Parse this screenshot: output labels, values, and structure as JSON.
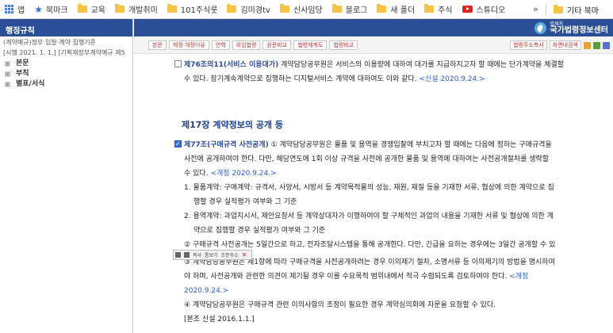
{
  "bookmarks": {
    "items": [
      {
        "label": "앱",
        "icon": "apps-grid-icon"
      },
      {
        "label": "북마크",
        "icon": "star-icon"
      },
      {
        "label": "교육",
        "icon": "folder-icon"
      },
      {
        "label": "개발취미",
        "icon": "folder-icon"
      },
      {
        "label": "101주식룻",
        "icon": "folder-icon"
      },
      {
        "label": "김미경tv",
        "icon": "folder-icon"
      },
      {
        "label": "신사임당",
        "icon": "folder-icon"
      },
      {
        "label": "블로그",
        "icon": "folder-icon"
      },
      {
        "label": "새 폴더",
        "icon": "folder-icon"
      },
      {
        "label": "주식",
        "icon": "folder-icon"
      },
      {
        "label": "스튜디오",
        "icon": "youtube-icon"
      }
    ],
    "overflow": "»",
    "other_label": "기타 북마"
  },
  "sidebar": {
    "title": "행정규칙",
    "subtitle_line1": "(계약예규)정부 입찰·계약 집행기준",
    "subtitle_line2": "[시행 2021. 1. 1.] [기획재정부계약예규 제5",
    "tree": [
      "본문",
      "부칙",
      "별표/서식"
    ]
  },
  "header": {
    "logo_small": "법제처",
    "logo_big": "국가법령정보센터"
  },
  "toolbar": {
    "buttons": [
      "본문",
      "제정·개정이유",
      "연혁",
      "위임법령",
      "원문비교",
      "법령체계도",
      "법령비교"
    ],
    "right_buttons": [
      "법령주소복사",
      "화면내검색"
    ]
  },
  "content": {
    "art76_title": "제76조의11(서비스 이용대가)",
    "art76_text1": " 계약담당공무원은 서비스의 이용량에 대하여 대가를 지급하지고자 할 때에는 단가계약을 체결할",
    "art76_text2": "수 있다. 장기계속계약으로 집행하는 디지털서비스 계약에 대하여도 이와 같다.",
    "art76_amend": "<신설 2020.9.24.>",
    "chapter": "제17장 계약정보의 공개 등",
    "art77_title": "제77조(구매규격 사전공개)",
    "art77_l1": " ① 계약담당공무원은 물품 및 용역을 경쟁입찰에 부치고자 할 때에는 다음에 정하는 구매규격을",
    "art77_l2": "사전에 공개하여야 한다. 다만, 해당연도에 1회 이상 규격을 사전에 공개한 물품 및 용역에 대하여는 사전공개절차를 생략할",
    "art77_l3": "수 있다.",
    "art77_amend1": "<개정 2020.9.24.>",
    "item1_l1": "1. 물품계약: 구매계약: 규격서, 사양서, 시방서 등 계약목적물의 성능, 재원, 재질 등을 기재한 서류, 협상에 의한 계약으로 집",
    "item1_l2": "행할 경우 실적평가 여부와 그 기준",
    "item2_l1": "2. 용역계약: 과업지시서, 제안요청서 등 계약상대자가 이행하여야 할 구체적인 과업의 내용을 기재한 서류 및 협상에 의한 계",
    "item2_l2": "약으로 집행할 경우 실적평가 여부와 그 기준",
    "para2": "② 구매규격 사전공개는 5일간으로 하고, 전자조달시스템을 통해 공개한다. 다만, 긴급을 요하는 경우에는 3일간 공개할 수 있",
    "para3_l1": "③ 계약담당공무원은 제1항에 따라 구매규격을 사전공개하려는 경우 이의제기 절차, 소명서류 등 이의제기의 방법을 명시하여",
    "para3_l2": "야 하며, 사전공개와 관련한 의견이 제기될 경우 이를 수요목적 범위내에서 적극 수렴되도록 검토하여야 한다.",
    "para3_amend_a": "<개정",
    "para3_amend_b": "2020.9.24.>",
    "para4": "④ 계약담당공무원은 구매규격 관련 이의사항의 조정이 필요한 경우 계약심의회에 자문을 요청할 수 있다.",
    "para4_note": "[본조 신설 2016.1.1.]"
  },
  "popup": {
    "items": [
      "복사",
      "통보기",
      "조문주소"
    ]
  }
}
